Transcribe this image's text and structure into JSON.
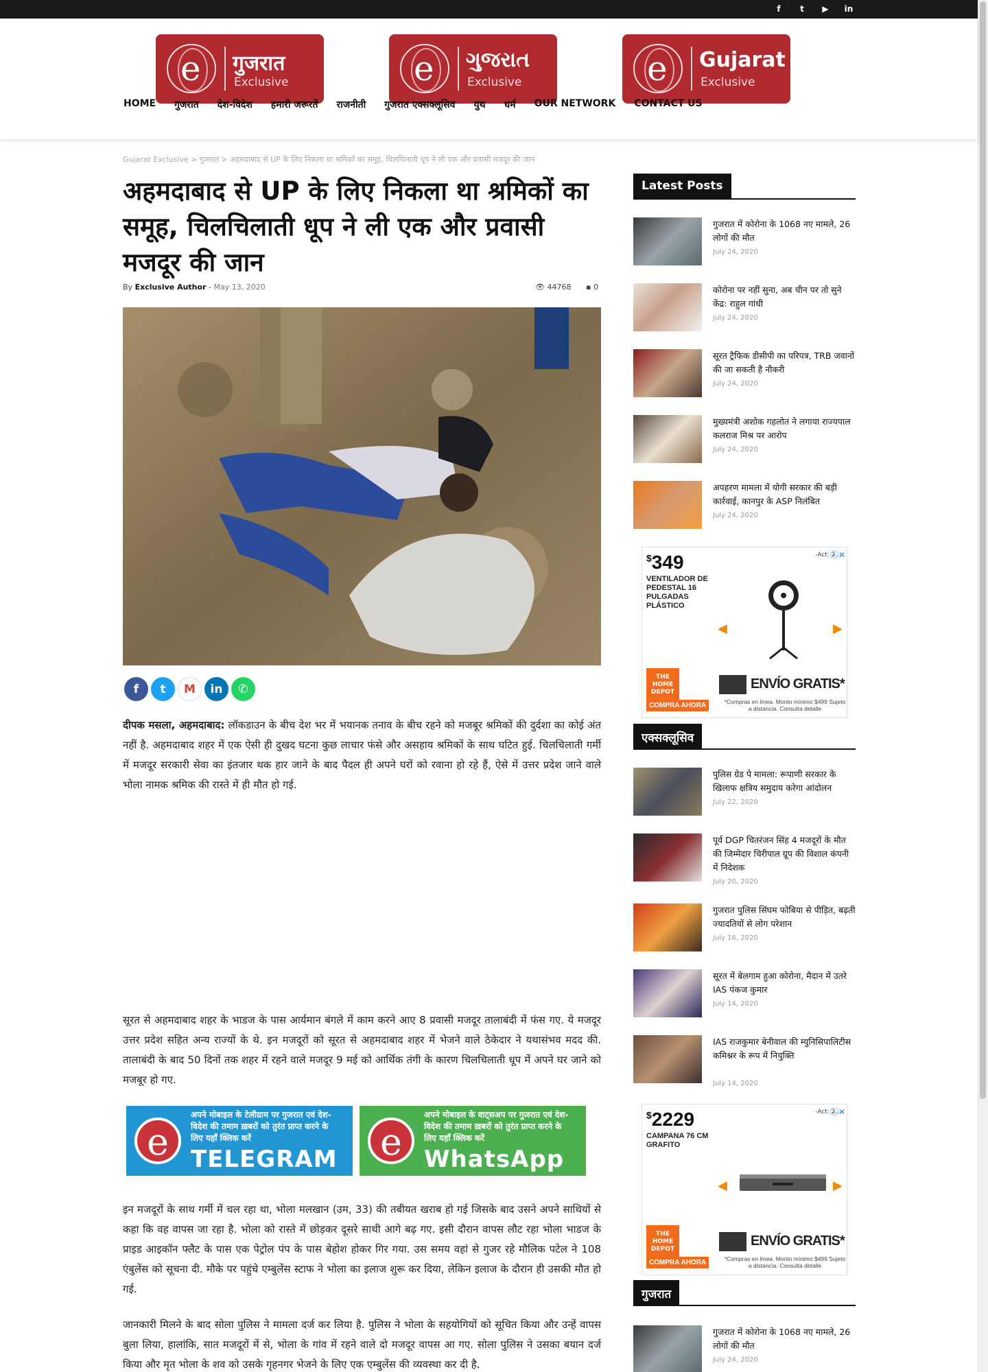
{
  "social": [
    "f",
    "t",
    "▶",
    "in"
  ],
  "logos": [
    {
      "name": "ગુજરાત",
      "sub": "Exclusive"
    },
    {
      "name": "ગુજરાત",
      "sub": "Exclusive"
    },
    {
      "name": "Gujarat",
      "sub": "Exclusive"
    }
  ],
  "logo_hindi": "गुजरात",
  "nav": [
    "HOME",
    "गुजरात",
    "देश-विदेश",
    "हमारी जरूरतें",
    "राजनीती",
    "गुजरात एक्सक्लूसिव",
    "युथ",
    "धर्म",
    "OUR NETWORK",
    "CONTACT US"
  ],
  "breadcrumb": "Gujarat Exclusive > गुजरात > अहमदाबाद से UP के लिए निकला था श्रमिकों का समूह, चिलचिलाती धूप ने ली एक और प्रवासी मजदूर की जान",
  "article": {
    "title": "अहमदाबाद से UP के लिए निकला था श्रमिकों का समूह, चिलचिलाती धूप ने ली एक और प्रवासी मजदूर की जान",
    "by": "By",
    "author": "Exclusive Author",
    "date": "May 13, 2020",
    "views": "44768",
    "comments": "0",
    "lead_bold": "दीपक मसला, अहमदाबाद:",
    "lead": " लॉकडाउन के बीच देश भर में भयानक तनाव के बीच रहने को मजबूर श्रमिकों की दुर्दशा का कोई अंत नहीं है. अहमदाबाद शहर में एक ऐसी ही दुखद घटना कुछ लाचार फंसे और असहाय श्रमिकों के साथ घटित हुई. चिलचिलाती गर्मी में मजदूर सरकारी सेवा का इंतजार थक हार जाने के बाद पैदल ही अपने घरों को रवाना हो रहे हैं, ऐसे में उत्तर प्रदेश जाने वाले भोला नामक श्रमिक की रास्ते में ही मौत हो गई.",
    "p2": "सूरत से अहमदाबाद शहर के भाडज के पास आर्यमान बंगले में काम करने आए 8 प्रवासी मजदूर तालाबंदी में फंस गए. ये मजदूर उत्तर प्रदेश सहित अन्य राज्यों के थे. इन मजदूरों को सूरत से अहमदाबाद शहर में भेजने वाले ठेकेदार ने यथासंभव मदद की. तालाबंदी के बाद 50 दिनों तक शहर में रहने वाले मजदूर 9 मई को आर्थिक तंगी के कारण चिलचिलाती धूप में अपने घर जाने को मजबूर हो गए.",
    "p3": "इन मजदूरों के साथ गर्मी में चल रहा था, भोला मलखान (उम, 33) की तबीयत खराब हो गई जिसके बाद उसने अपने साथियों से कहा कि वह वापस जा रहा है. भोला को रास्ते में छोड़कर दूसरे साथी आगे बढ़ गए. इसी दौरान वापस लौट रहा भोला भाडज के प्राइड आइकॉन फ्लैट के पास एक पेट्रोल पंप के पास बेहोश होकर गिर गया. उस समय वहां से गुजर रहे मौलिक पटेल ने 108 एंबुलेंस को सूचना दी. मौके पर पहुंचे एम्बुलेंस स्टाफ ने भोला का इलाज शुरू कर दिया, लेकिन इलाज के दौरान ही उसकी मौत हो गई.",
    "p4": "जानकारी मिलने के बाद सोला पुलिस ने मामला दर्ज कर लिया है. पुलिस ने भोला के सहयोगियों को सूचित किया और उन्हें वापस बुला लिया, हालांकि, सात मजदूरों में से, भोला के गांव में रहने वाले दो मजदूर वापस आ गए. सोला पुलिस ने उसका बयान दर्ज किया और मृत भोला के शव को उसके गृहनगर भेजने के लिए एक एम्बुलेंस की व्यवस्था कर दी है."
  },
  "share": [
    "f",
    "t",
    "M",
    "in",
    "✆"
  ],
  "banners": [
    {
      "small": "अपने मोबाइल के टेलीग्राम पर गुजरात एवं देश-विदेश की तमाम ख़बरों को तुरंत प्राप्त करने के लिए यहाँ क्लिक करें",
      "big": "TELEGRAM",
      "color": "#2196d3"
    },
    {
      "small": "अपने मोबाइल के वाट्सअप पर गुजरात एवं देश-विदेश की तमाम ख़बरों को तुरंत प्राप्त करने के लिए यहाँ क्लिक करें",
      "big": "WhatsApp",
      "color": "#4caf50"
    }
  ],
  "sidebar": {
    "latest_title": "Latest Posts",
    "latest": [
      {
        "title": "गुजरात में कोरोना के 1068 नए मामले, 26 लोगों की मौत",
        "date": "July 24, 2020"
      },
      {
        "title": "कोरोना पर नहीं सुना, अब चीन पर तो सुने केंद्र: राहुल गांधी",
        "date": "July 24, 2020"
      },
      {
        "title": "सूरत ट्रैफिक डीसीपी का परिपत्र, TRB जवानों की जा सकती है नौकरी",
        "date": "July 24, 2020"
      },
      {
        "title": "मुख्यमंत्री अशोक गहलोत ने लगाया राज्यपाल कलराज मिश्र पर आरोप",
        "date": "July 24, 2020"
      },
      {
        "title": "अपहरण मामला में योगी सरकार की बड़ी कार्रवाई, कानपुर के ASP निलंबित",
        "date": "July 24, 2020"
      }
    ],
    "exclusive_title": "एक्सक्लूसिव",
    "exclusive": [
      {
        "title": "पुलिस ग्रेड पे मामला: रूपाणी सरकार के खिलाफ क्षत्रिय समुदाय करेगा आंदोलन",
        "date": "July 22, 2020"
      },
      {
        "title": "पूर्व DGP चितरंजन सिंह 4 मजदूरों के मौत की जिम्मेदार चिरीपाल ग्रूप की विशाल कंपनी में निदेशक",
        "date": "July 20, 2020"
      },
      {
        "title": "गुजरात पुलिस सिंघम फोबिया से पीड़ित, बढ़ती ज्यादतियों से लोग परेशान",
        "date": "July 16, 2020"
      },
      {
        "title": "सूरत में बेलगाम हुआ कोरोना, मैदान में उतरे IAS पंकज कुमार",
        "date": "July 14, 2020"
      },
      {
        "title": "IAS राजकुमार बेनीवाल की म्युनिसिपालिटीस कमिश्नर के रूप में नियुक्ति",
        "date": "July 14, 2020"
      }
    ],
    "gujarat_title": "गुजरात",
    "gujarat": [
      {
        "title": "गुजरात में कोरोना के 1068 नए मामले, 26 लोगों की मौत",
        "date": "July 24, 2020"
      }
    ]
  },
  "ads": [
    {
      "currency": "$",
      "price": "349",
      "desc": "VENTILADOR DE PEDESTAL 16 PULGADAS PLÁSTICO",
      "act": "-Act: 2...",
      "shipping": "ENVÍO GRATIS*",
      "cta": "COMPRA AHORA",
      "fine": "*Compras en línea. Monto mínimo $499 Sujeto a distancia. Consulta detalle",
      "brand": "THE HOME DEPOT"
    },
    {
      "currency": "$",
      "price": "2229",
      "desc": "CAMPANA 76 CM GRAFITO",
      "act": "-Act: 2...",
      "shipping": "ENVÍO GRATIS*",
      "cta": "COMPRA AHORA",
      "fine": "*Compras en línea. Monto mínimo $499 Sujeto a distancia. Consulta detalle",
      "brand": "THE HOME DEPOT"
    }
  ]
}
